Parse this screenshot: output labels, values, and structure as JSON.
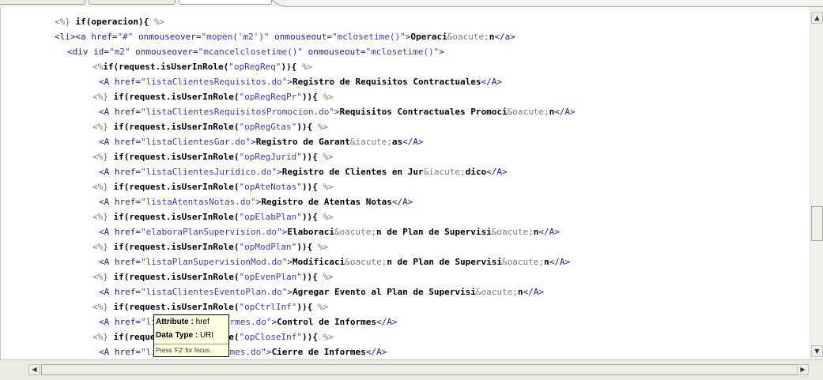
{
  "editor": {
    "lines": [
      {
        "indent": 0,
        "segments": [
          {
            "t": "jsp",
            "v": "<%} "
          },
          {
            "t": "kw",
            "v": "if(operacion){ "
          },
          {
            "t": "jsp",
            "v": "%>"
          }
        ]
      },
      {
        "indent": 0,
        "segments": [
          {
            "t": "tag",
            "v": "<li><a href="
          },
          {
            "t": "str",
            "v": "\"#\""
          },
          {
            "t": "tag",
            "v": " onmouseover="
          },
          {
            "t": "str",
            "v": "\"mopen('m2')\""
          },
          {
            "t": "tag",
            "v": " onmouseout="
          },
          {
            "t": "str",
            "v": "\"mclosetime()\""
          },
          {
            "t": "tag",
            "v": ">"
          },
          {
            "t": "txt",
            "v": "Operaci"
          },
          {
            "t": "ent",
            "v": "&oacute;"
          },
          {
            "t": "txt",
            "v": "n"
          },
          {
            "t": "tag",
            "v": "</a>"
          }
        ]
      },
      {
        "indent": 1,
        "segments": [
          {
            "t": "tag",
            "v": "<div id="
          },
          {
            "t": "str",
            "v": "\"m2\""
          },
          {
            "t": "tag",
            "v": " onmouseover="
          },
          {
            "t": "str",
            "v": "\"mcancelclosetime()\""
          },
          {
            "t": "tag",
            "v": " onmouseout="
          },
          {
            "t": "str",
            "v": "\"mclosetime()\""
          },
          {
            "t": "tag",
            "v": ">"
          }
        ]
      },
      {
        "indent": 2,
        "segments": [
          {
            "t": "jsp",
            "v": "<%"
          },
          {
            "t": "kw",
            "v": "if(request.isUserInRole("
          },
          {
            "t": "str",
            "v": "\"opRegReq\""
          },
          {
            "t": "kw",
            "v": ")){ "
          },
          {
            "t": "jsp",
            "v": "%>"
          }
        ]
      },
      {
        "indent": 3,
        "segments": [
          {
            "t": "tag",
            "v": "<A href="
          },
          {
            "t": "str",
            "v": "\"listaClientesRequisitos.do\""
          },
          {
            "t": "tag",
            "v": ">"
          },
          {
            "t": "txt",
            "v": "Registro de Requisitos Contractuales"
          },
          {
            "t": "tag",
            "v": "</A>"
          }
        ]
      },
      {
        "indent": 2,
        "segments": [
          {
            "t": "jsp",
            "v": "<%} "
          },
          {
            "t": "kw",
            "v": "if(request.isUserInRole("
          },
          {
            "t": "str",
            "v": "\"opRegReqPr\""
          },
          {
            "t": "kw",
            "v": ")){ "
          },
          {
            "t": "jsp",
            "v": "%>"
          }
        ]
      },
      {
        "indent": 3,
        "segments": [
          {
            "t": "tag",
            "v": "<A href="
          },
          {
            "t": "str",
            "v": "\"listaClientesRequisitosPromocion.do\""
          },
          {
            "t": "tag",
            "v": ">"
          },
          {
            "t": "txt",
            "v": "Requisitos Contractuales Promoci"
          },
          {
            "t": "ent",
            "v": "&oacute;"
          },
          {
            "t": "txt",
            "v": "n"
          },
          {
            "t": "tag",
            "v": "</A>"
          }
        ]
      },
      {
        "indent": 2,
        "segments": [
          {
            "t": "jsp",
            "v": "<%} "
          },
          {
            "t": "kw",
            "v": "if(request.isUserInRole("
          },
          {
            "t": "str",
            "v": "\"opRegGtas\""
          },
          {
            "t": "kw",
            "v": ")){ "
          },
          {
            "t": "jsp",
            "v": "%>"
          }
        ]
      },
      {
        "indent": 3,
        "segments": [
          {
            "t": "tag",
            "v": "<A href="
          },
          {
            "t": "str",
            "v": "\"listaClientesGar.do\""
          },
          {
            "t": "tag",
            "v": ">"
          },
          {
            "t": "txt",
            "v": "Registro de Garant"
          },
          {
            "t": "ent",
            "v": "&iacute;"
          },
          {
            "t": "txt",
            "v": "as"
          },
          {
            "t": "tag",
            "v": "</A>"
          }
        ]
      },
      {
        "indent": 2,
        "segments": [
          {
            "t": "jsp",
            "v": "<%} "
          },
          {
            "t": "kw",
            "v": "if(request.isUserInRole("
          },
          {
            "t": "str",
            "v": "\"opRegJurid\""
          },
          {
            "t": "kw",
            "v": ")){ "
          },
          {
            "t": "jsp",
            "v": "%>"
          }
        ]
      },
      {
        "indent": 3,
        "segments": [
          {
            "t": "tag",
            "v": "<A href="
          },
          {
            "t": "str",
            "v": "\"listaClientesJuridico.do\""
          },
          {
            "t": "tag",
            "v": ">"
          },
          {
            "t": "txt",
            "v": "Registro de Clientes en Jur"
          },
          {
            "t": "ent",
            "v": "&iacute;"
          },
          {
            "t": "txt",
            "v": "dico"
          },
          {
            "t": "tag",
            "v": "</A>"
          }
        ]
      },
      {
        "indent": 2,
        "segments": [
          {
            "t": "jsp",
            "v": "<%} "
          },
          {
            "t": "kw",
            "v": "if(request.isUserInRole("
          },
          {
            "t": "str",
            "v": "\"opAteNotas\""
          },
          {
            "t": "kw",
            "v": ")){ "
          },
          {
            "t": "jsp",
            "v": "%>"
          }
        ]
      },
      {
        "indent": 3,
        "segments": [
          {
            "t": "tag",
            "v": "<A href="
          },
          {
            "t": "str",
            "v": "\"listaAtentasNotas.do\""
          },
          {
            "t": "tag",
            "v": ">"
          },
          {
            "t": "txt",
            "v": "Registro de Atentas Notas"
          },
          {
            "t": "tag",
            "v": "</A>"
          }
        ]
      },
      {
        "indent": 2,
        "segments": [
          {
            "t": "jsp",
            "v": "<%} "
          },
          {
            "t": "kw",
            "v": "if(request.isUserInRole("
          },
          {
            "t": "str",
            "v": "\"opElabPlan\""
          },
          {
            "t": "kw",
            "v": ")){ "
          },
          {
            "t": "jsp",
            "v": "%>"
          }
        ]
      },
      {
        "indent": 3,
        "segments": [
          {
            "t": "tag",
            "v": "<A href="
          },
          {
            "t": "str",
            "v": "\"elaboraPlanSupervision.do\""
          },
          {
            "t": "tag",
            "v": ">"
          },
          {
            "t": "txt",
            "v": "Elaboraci"
          },
          {
            "t": "ent",
            "v": "&oacute;"
          },
          {
            "t": "txt",
            "v": "n de Plan de Supervisi"
          },
          {
            "t": "ent",
            "v": "&oacute;"
          },
          {
            "t": "txt",
            "v": "n"
          },
          {
            "t": "tag",
            "v": "</A>"
          }
        ]
      },
      {
        "indent": 2,
        "segments": [
          {
            "t": "jsp",
            "v": "<%} "
          },
          {
            "t": "kw",
            "v": "if(request.isUserInRole("
          },
          {
            "t": "str",
            "v": "\"opModPlan\""
          },
          {
            "t": "kw",
            "v": ")){ "
          },
          {
            "t": "jsp",
            "v": "%>"
          }
        ]
      },
      {
        "indent": 3,
        "segments": [
          {
            "t": "tag",
            "v": "<A href="
          },
          {
            "t": "str",
            "v": "\"listaPlanSupervisionMod.do\""
          },
          {
            "t": "tag",
            "v": ">"
          },
          {
            "t": "txt",
            "v": "Modificaci"
          },
          {
            "t": "ent",
            "v": "&oacute;"
          },
          {
            "t": "txt",
            "v": "n de Plan de Supervisi"
          },
          {
            "t": "ent",
            "v": "&oacute;"
          },
          {
            "t": "txt",
            "v": "n"
          },
          {
            "t": "tag",
            "v": "</A>"
          }
        ]
      },
      {
        "indent": 2,
        "segments": [
          {
            "t": "jsp",
            "v": "<%} "
          },
          {
            "t": "kw",
            "v": "if(request.isUserInRole("
          },
          {
            "t": "str",
            "v": "\"opEvenPlan\""
          },
          {
            "t": "kw",
            "v": ")){ "
          },
          {
            "t": "jsp",
            "v": "%>"
          }
        ]
      },
      {
        "indent": 3,
        "segments": [
          {
            "t": "tag",
            "v": "<A href="
          },
          {
            "t": "str",
            "v": "\"listaClientesEventoPlan.do\""
          },
          {
            "t": "tag",
            "v": ">"
          },
          {
            "t": "txt",
            "v": "Agregar Evento al Plan de Supervisi"
          },
          {
            "t": "ent",
            "v": "&oacute;"
          },
          {
            "t": "txt",
            "v": "n"
          },
          {
            "t": "tag",
            "v": "</A>"
          }
        ]
      },
      {
        "indent": 2,
        "segments": [
          {
            "t": "jsp",
            "v": "<%} "
          },
          {
            "t": "kw",
            "v": "if(req"
          },
          {
            "t": "kw",
            "v": "uest.isUser"
          },
          {
            "t": "kw",
            "v": "InRole("
          },
          {
            "t": "str",
            "v": "\"opCtrlInf\""
          },
          {
            "t": "kw",
            "v": ")){ "
          },
          {
            "t": "jsp",
            "v": "%>"
          }
        ]
      },
      {
        "indent": 3,
        "segments": [
          {
            "t": "tag",
            "v": "<A href="
          },
          {
            "t": "str",
            "v": "\"listaControlInformes.do\""
          },
          {
            "t": "tag",
            "v": ">"
          },
          {
            "t": "txt",
            "v": "Control de Informes"
          },
          {
            "t": "tag",
            "v": "</A>"
          }
        ]
      },
      {
        "indent": 2,
        "segments": [
          {
            "t": "jsp",
            "v": "<%} "
          },
          {
            "t": "kw",
            "v": "if(req"
          },
          {
            "t": "kw",
            "v": "uest.isUser"
          },
          {
            "t": "kw",
            "v": "InRole("
          },
          {
            "t": "str",
            "v": "\"opCloseInf\""
          },
          {
            "t": "kw",
            "v": ")){ "
          },
          {
            "t": "jsp",
            "v": "%>"
          }
        ]
      },
      {
        "indent": 3,
        "segments": [
          {
            "t": "tag",
            "v": "<A href="
          },
          {
            "t": "str",
            "v": "\"listaCierreInformes.do\""
          },
          {
            "t": "tag",
            "v": ">"
          },
          {
            "t": "txt",
            "v": "Cierre de Informes"
          },
          {
            "t": "tag",
            "v": "</A>"
          }
        ]
      }
    ]
  },
  "tooltip": {
    "attribute_label": "Attribute :",
    "attribute_value": "href",
    "datatype_label": "Data Type :",
    "datatype_value": "URI",
    "hint": "Press 'F2' for focus."
  },
  "scroll": {
    "up_arrow": "▲",
    "down_arrow": "▼",
    "left_arrow": "◀",
    "right_arrow": "▶"
  }
}
